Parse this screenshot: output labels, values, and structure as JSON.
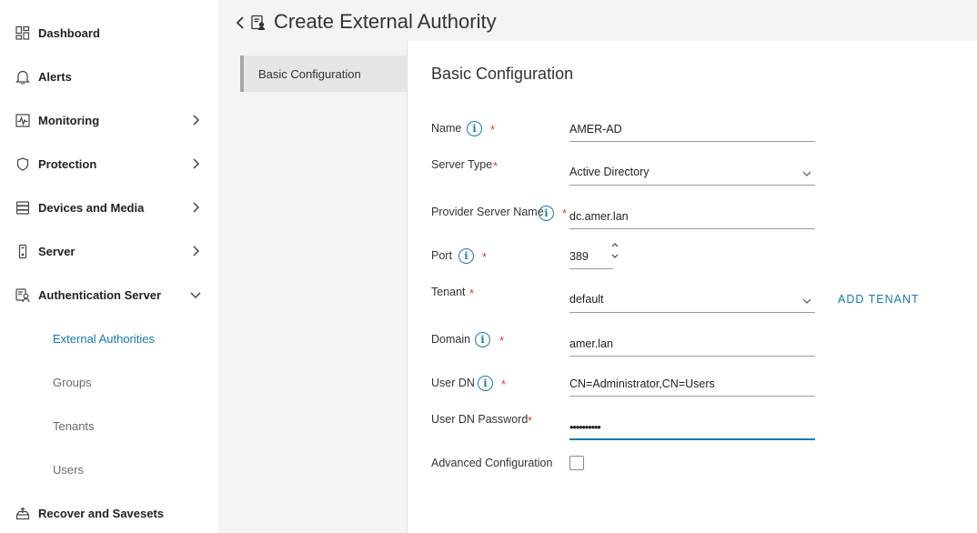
{
  "header": {
    "title": "Create External Authority"
  },
  "sidebar": {
    "items": [
      {
        "label": "Dashboard"
      },
      {
        "label": "Alerts"
      },
      {
        "label": "Monitoring"
      },
      {
        "label": "Protection"
      },
      {
        "label": "Devices and Media"
      },
      {
        "label": "Server"
      },
      {
        "label": "Authentication Server"
      },
      {
        "label": "Recover and Savesets"
      }
    ],
    "sub_items": [
      {
        "label": "External Authorities",
        "active": true
      },
      {
        "label": "Groups"
      },
      {
        "label": "Tenants"
      },
      {
        "label": "Users"
      }
    ]
  },
  "section_nav": {
    "label": "Basic Configuration"
  },
  "form": {
    "title": "Basic Configuration",
    "required_mark": "*",
    "info_glyph": "i",
    "name": {
      "label": "Name",
      "value": "AMER-AD"
    },
    "server_type": {
      "label": "Server Type",
      "value": "Active Directory"
    },
    "provider_server_name": {
      "label": "Provider Server Name",
      "value": "dc.amer.lan"
    },
    "port": {
      "label": "Port",
      "value": "389"
    },
    "tenant": {
      "label": "Tenant",
      "value": "default",
      "add_label": "ADD TENANT"
    },
    "domain": {
      "label": "Domain",
      "value": "amer.lan"
    },
    "user_dn": {
      "label": "User DN",
      "value": "CN=Administrator,CN=Users"
    },
    "user_dn_password": {
      "label": "User DN Password",
      "value": "••••••••••"
    },
    "advanced_configuration": {
      "label": "Advanced Configuration",
      "checked": false
    }
  },
  "colors": {
    "accent": "#1a7aa8",
    "required": "#d83a3a",
    "panel_bg": "#f4f4f4"
  },
  "icons": [
    "dashboard-icon",
    "bell-icon",
    "monitoring-icon",
    "shield-icon",
    "storage-icon",
    "server-icon",
    "auth-server-icon",
    "recover-icon",
    "chevron-right-icon",
    "chevron-down-icon",
    "back-arrow-icon",
    "document-user-icon",
    "info-icon",
    "spinner-arrows-icon"
  ]
}
